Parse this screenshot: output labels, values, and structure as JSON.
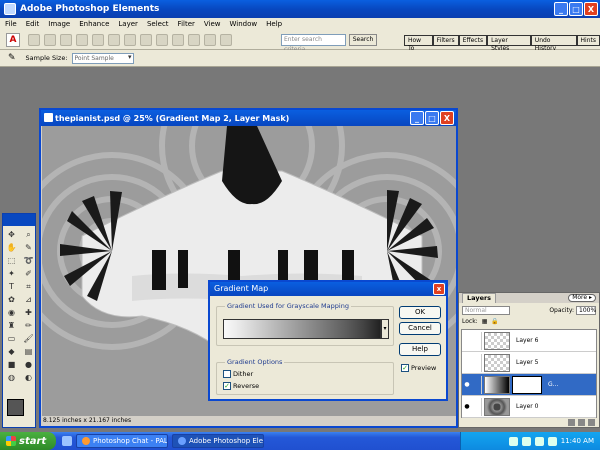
{
  "app": {
    "title": "Adobe Photoshop Elements",
    "window_controls": [
      "_",
      "□",
      "X"
    ]
  },
  "menu": [
    "File",
    "Edit",
    "Image",
    "Enhance",
    "Layer",
    "Select",
    "Filter",
    "View",
    "Window",
    "Help"
  ],
  "toolbar": {
    "search_placeholder": "Enter search criteria",
    "search_button": "Search",
    "palette_tabs": [
      "How To",
      "Filters",
      "Effects",
      "Layer Styles",
      "Undo History",
      "Hints"
    ]
  },
  "options_bar": {
    "sample_size_label": "Sample Size:",
    "sample_size_value": "Point Sample"
  },
  "document": {
    "title": "thepianist.psd @ 25% (Gradient Map 2, Layer Mask)",
    "status": "8.125 inches x 21.167 inches"
  },
  "dialog": {
    "title": "Gradient Map",
    "group1_label": "Gradient Used for Grayscale Mapping",
    "group2_label": "Gradient Options",
    "dither_label": "Dither",
    "dither_checked": false,
    "reverse_label": "Reverse",
    "reverse_checked": true,
    "ok": "OK",
    "cancel": "Cancel",
    "help": "Help",
    "preview_label": "Preview",
    "preview_checked": true
  },
  "layers": {
    "tab": "Layers",
    "more": "More ▸",
    "blend_mode": "Normal",
    "opacity_label": "Opacity:",
    "opacity_value": "100%",
    "lock_label": "Lock:",
    "items": [
      {
        "name": "Layer 6"
      },
      {
        "name": "Layer 5"
      },
      {
        "name": "G..."
      },
      {
        "name": "Layer 0"
      }
    ]
  },
  "taskbar": {
    "start": "start",
    "tasks": [
      "Photoshop Chat - PAL...",
      "Adobe Photoshop Ele..."
    ],
    "clock": "11:40 AM"
  }
}
